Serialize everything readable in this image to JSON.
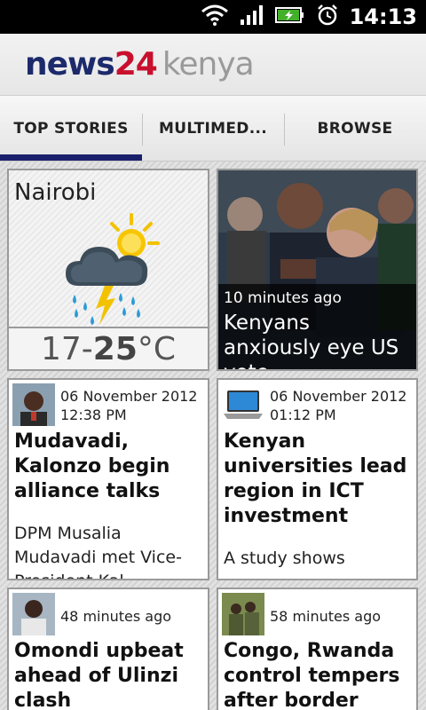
{
  "status_bar": {
    "time": "14:13",
    "icons": [
      "wifi-icon",
      "signal-icon",
      "battery-charging-icon",
      "alarm-icon"
    ]
  },
  "header": {
    "logo_part1": "news",
    "logo_part2": "24",
    "logo_part3": "kenya"
  },
  "tabs": [
    {
      "label": "TOP STORIES",
      "active": true
    },
    {
      "label": "MULTIMED...",
      "active": false
    },
    {
      "label": "BROWSE",
      "active": false
    }
  ],
  "weather": {
    "city": "Nairobi",
    "temp_low": "17-",
    "temp_high": "25",
    "unit": "°C",
    "icon": "thunderstorm-sun-icon"
  },
  "featured": {
    "ago": "10 minutes ago",
    "headline": "Kenyans anxiously eye US vote"
  },
  "stories": [
    {
      "date": "06 November 2012",
      "time": "12:38 PM",
      "title": "Mudavadi, Kalonzo begin alliance talks",
      "desc": "DPM Musalia Mudavadi met Vice-President Kal..."
    },
    {
      "date": "06 November 2012",
      "time": "01:12 PM",
      "title": "Kenyan universities lead region in ICT investment",
      "desc": "A study shows"
    },
    {
      "date": "48 minutes ago",
      "time": "",
      "title": "Omondi upbeat ahead of Ulinzi clash",
      "desc": ""
    },
    {
      "date": "58 minutes ago",
      "time": "",
      "title": "Congo, Rwanda control tempers after border",
      "desc": ""
    }
  ]
}
